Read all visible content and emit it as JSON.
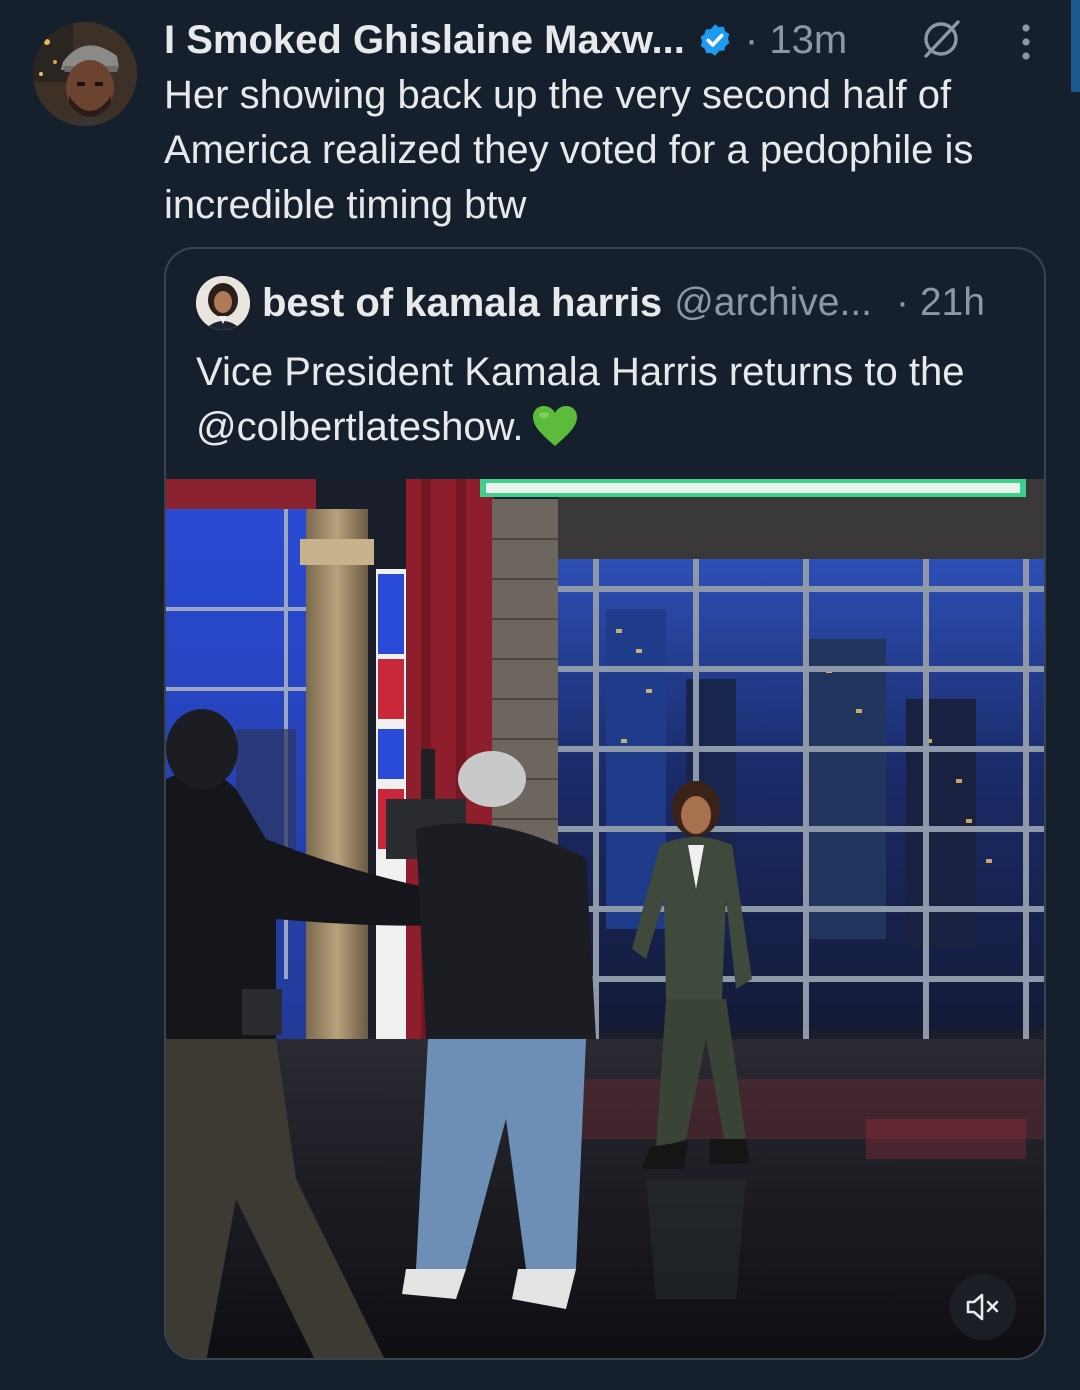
{
  "tweet": {
    "author_name": "I Smoked Ghislaine Maxw...",
    "time": "· 13m",
    "text": "Her showing back up the very second half of America realized they voted for a pedophile is incredible timing btw"
  },
  "quoted_tweet": {
    "author_name": "best of kamala harris",
    "handle": "@archive...",
    "time": "· 21h",
    "text": "Vice President Kamala Harris returns to the @colbertlateshow."
  },
  "icons": {
    "verified": "verified-badge-icon",
    "grok": "grok-icon",
    "more": "more-vertical-icon",
    "heart": "green-heart-emoji",
    "mute": "muted-speaker-icon"
  },
  "colors": {
    "background": "#16202c",
    "text_primary": "#e7e9ea",
    "text_secondary": "#8b98a5",
    "verified_blue": "#1d9bf0",
    "card_border": "#38444d",
    "heart_green": "#5cbb3b"
  }
}
